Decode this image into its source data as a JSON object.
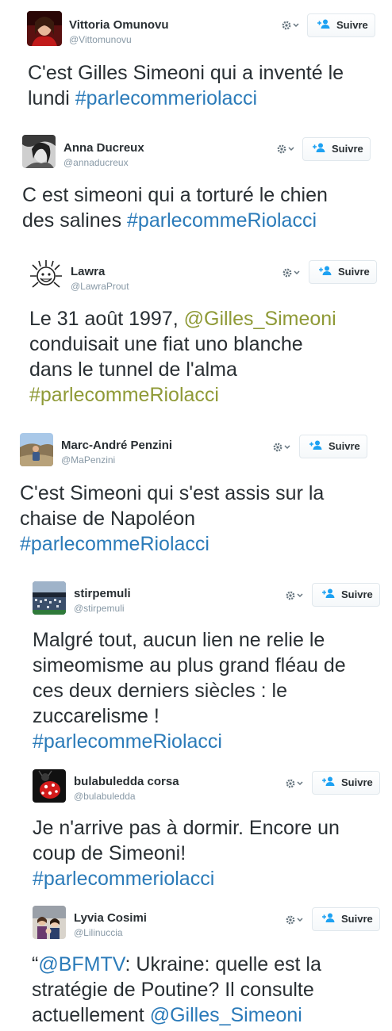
{
  "colors": {
    "hashtag_blue": "#2b7bb9",
    "hashtag_olive": "#8f9a37",
    "name_text": "#292f33",
    "handle_text": "#8899a6"
  },
  "tweets": [
    {
      "name": "Vittoria Omunovu",
      "handle": "@Vittomunovu",
      "follow_label": "Suivre",
      "avatar_icon": "avatar-woman-red-dress",
      "lines": [
        [
          "C'est Gilles Simeoni qui a inventé le"
        ],
        [
          "lundi ",
          {
            "t": "#parlecommeriolacci",
            "c": "blue"
          }
        ]
      ]
    },
    {
      "name": "Anna Ducreux",
      "handle": "@annaducreux",
      "follow_label": "Suivre",
      "avatar_icon": "avatar-woman-bw",
      "lines": [
        [
          "C est simeoni qui a torturé le chien"
        ],
        [
          "des salines ",
          {
            "t": "#parlecommeRiolacci",
            "c": "blue"
          }
        ]
      ]
    },
    {
      "name": "Lawra",
      "handle": "@LawraProut",
      "follow_label": "Suivre",
      "avatar_icon": "avatar-sun-drawing",
      "lines": [
        [
          "Le 31 août 1997, ",
          {
            "t": "@Gilles_Simeoni",
            "c": "olive"
          }
        ],
        [
          "conduisait une fiat uno blanche"
        ],
        [
          "dans le tunnel de l'alma"
        ],
        [
          {
            "t": "#parlecommeRiolacci",
            "c": "olive"
          }
        ]
      ]
    },
    {
      "name": "Marc-André Penzini",
      "handle": "@MaPenzini",
      "follow_label": "Suivre",
      "avatar_icon": "avatar-man-landscape",
      "lines": [
        [
          "C'est Simeoni qui s'est assis sur la"
        ],
        [
          "chaise de Napoléon"
        ],
        [
          {
            "t": "#parlecommeRiolacci",
            "c": "blue"
          }
        ]
      ]
    },
    {
      "name": "stirpemuli",
      "handle": "@stirpemuli",
      "follow_label": "Suivre",
      "avatar_icon": "avatar-stadium-crowd",
      "lines": [
        [
          "Malgré tout, aucun lien ne relie le"
        ],
        [
          "simeomisme au plus grand fléau de"
        ],
        [
          "ces deux derniers siècles : le"
        ],
        [
          "zuccarelisme !"
        ],
        [
          {
            "t": "#parlecommeRiolacci",
            "c": "blue"
          }
        ]
      ]
    },
    {
      "name": "bulabuledda corsa",
      "handle": "@bulabuledda",
      "follow_label": "Suivre",
      "avatar_icon": "avatar-ladybug",
      "lines": [
        [
          "Je n'arrive pas à dormir.  Encore un"
        ],
        [
          "coup de Simeoni!"
        ],
        [
          {
            "t": "#parlecommeriolacci",
            "c": "blue"
          }
        ]
      ]
    },
    {
      "name": "Lyvia Cosimi",
      "handle": "@Lilinuccia",
      "follow_label": "Suivre",
      "avatar_icon": "avatar-group-photo",
      "lines": [
        [
          "“",
          {
            "t": "@BFMTV",
            "c": "blue"
          },
          ": Ukraine: quelle est la"
        ],
        [
          "stratégie de Poutine? Il consulte"
        ],
        [
          "actuellement ",
          {
            "t": "@Gilles_Simeoni",
            "c": "blue"
          }
        ]
      ]
    }
  ]
}
